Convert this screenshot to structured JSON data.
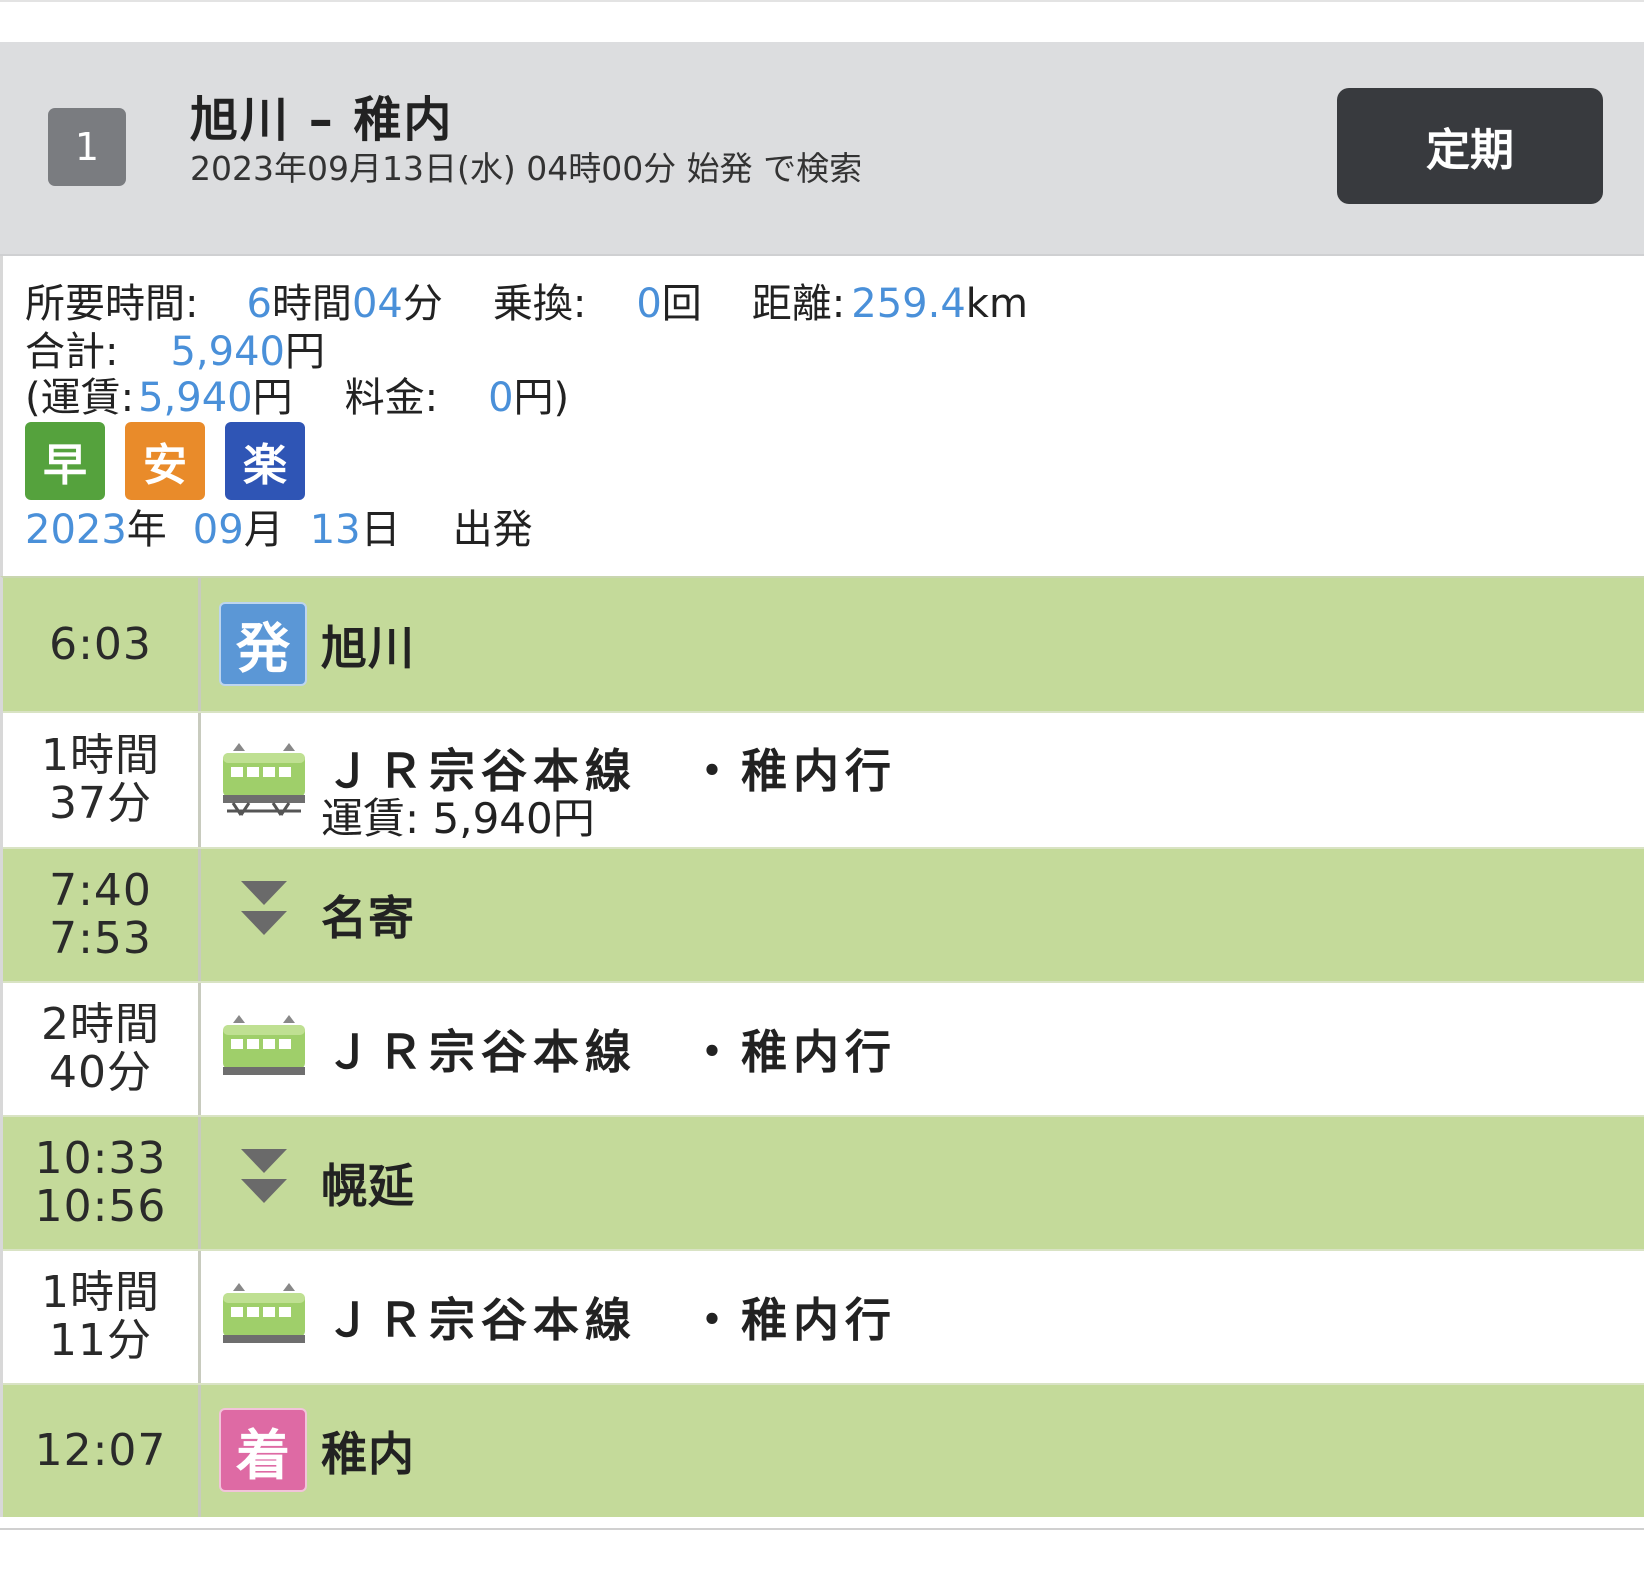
{
  "header": {
    "route_number": "1",
    "title": "旭川 – 稚内",
    "subtitle": "2023年09月13日(水) 04時00分 始発 で検索",
    "teiki_button": "定期"
  },
  "summary": {
    "duration_label": "所要時間:",
    "duration_hours": "6",
    "duration_hours_unit": "時間",
    "duration_minutes": "04",
    "duration_minutes_unit": "分",
    "transfer_label": "乗換:",
    "transfer_count": "0",
    "transfer_unit": "回",
    "distance_label": "距離:",
    "distance_value": "259.4",
    "distance_unit": "km",
    "total_label": "合計:",
    "total_value": "5,940",
    "yen": "円",
    "fare_open": "(運賃:",
    "fare_value": "5,940",
    "fee_label": "料金:",
    "fee_value": "0",
    "fee_close": "円)",
    "badges": [
      {
        "label": "早",
        "color": "#55a23d"
      },
      {
        "label": "安",
        "color": "#e98b2a"
      },
      {
        "label": "楽",
        "color": "#2f55b5"
      }
    ],
    "date_year": "2023",
    "date_year_unit": "年",
    "date_month": "09",
    "date_month_unit": "月",
    "date_day": "13",
    "date_day_unit": "日",
    "date_suffix": "出発"
  },
  "rows": [
    {
      "type": "station",
      "time1": "6:03",
      "time2": "",
      "icon": "発",
      "icon_color": "#5b97d6",
      "name": "旭川"
    },
    {
      "type": "train",
      "time1": "1時間",
      "time2": "37分",
      "line": "ＪＲ宗谷本線　・稚内行",
      "fare": "運賃: 5,940円"
    },
    {
      "type": "transfer",
      "time1": "7:40",
      "time2": "7:53",
      "name": "名寄"
    },
    {
      "type": "train",
      "time1": "2時間",
      "time2": "40分",
      "line": "ＪＲ宗谷本線　・稚内行",
      "fare": ""
    },
    {
      "type": "transfer",
      "time1": "10:33",
      "time2": "10:56",
      "name": "幌延"
    },
    {
      "type": "train",
      "time1": "1時間",
      "time2": "11分",
      "line": "ＪＲ宗谷本線　・稚内行",
      "fare": ""
    },
    {
      "type": "station",
      "time1": "12:07",
      "time2": "",
      "icon": "着",
      "icon_color": "#de6aa4",
      "name": "稚内"
    }
  ],
  "colors": {
    "accent_blue": "#4a90d9",
    "row_green": "#c4da9a",
    "header_gray": "#dcdddf",
    "button_dark": "#383a3e"
  }
}
